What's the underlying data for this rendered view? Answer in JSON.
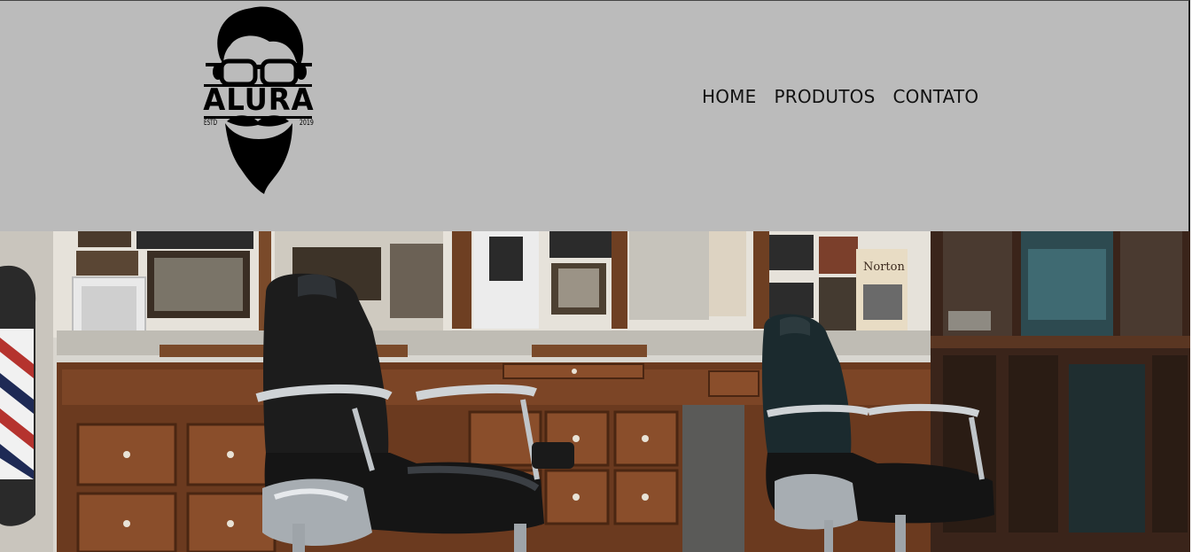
{
  "header": {
    "background_color": "#bbbbbb",
    "logo": {
      "icon": "bearded-man-with-glasses-icon",
      "wordmark": "ALURA",
      "estd": "ESTD",
      "year": "2019"
    },
    "nav": {
      "items": [
        {
          "label": "HOME"
        },
        {
          "label": "PRODUTOS"
        },
        {
          "label": "CONTATO"
        }
      ]
    }
  },
  "hero": {
    "image": "barbershop-interior-photo",
    "poster_text": "Norton"
  }
}
